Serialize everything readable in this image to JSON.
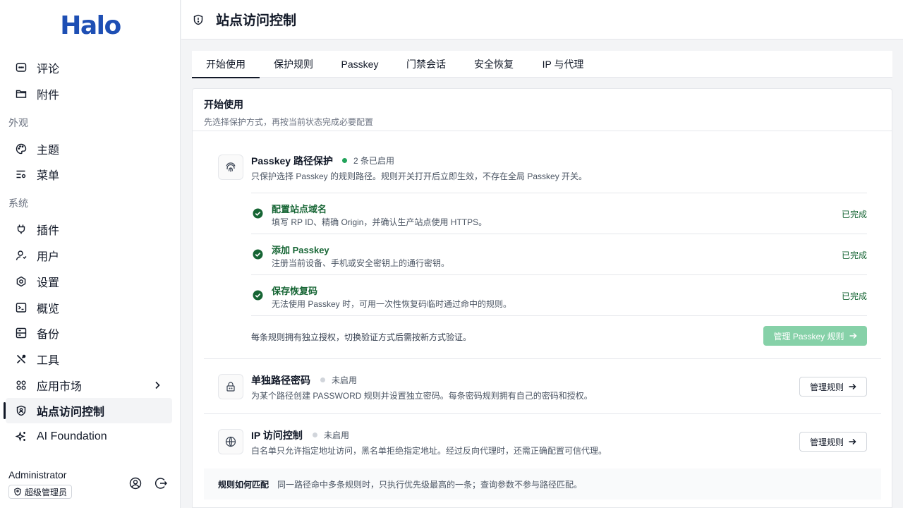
{
  "app": {
    "logo": "Halo"
  },
  "sidebar": {
    "items": [
      {
        "label": "评论",
        "icon": "comment-icon"
      },
      {
        "label": "附件",
        "icon": "folder-icon"
      },
      {
        "label": "主题",
        "icon": "palette-icon"
      },
      {
        "label": "菜单",
        "icon": "menu-settings-icon"
      },
      {
        "label": "插件",
        "icon": "plug-icon"
      },
      {
        "label": "用户",
        "icon": "user-icon"
      },
      {
        "label": "设置",
        "icon": "settings-icon"
      },
      {
        "label": "概览",
        "icon": "terminal-icon"
      },
      {
        "label": "备份",
        "icon": "backup-icon"
      },
      {
        "label": "工具",
        "icon": "tools-icon"
      },
      {
        "label": "应用市场",
        "icon": "apps-icon"
      },
      {
        "label": "站点访问控制",
        "icon": "shield-user-icon",
        "active": true
      },
      {
        "label": "AI Foundation",
        "icon": "sparkles-icon"
      }
    ],
    "groups": {
      "appearance": "外观",
      "system": "系统"
    },
    "user": {
      "name": "Administrator",
      "role": "超级管理员"
    }
  },
  "header": {
    "title": "站点访问控制"
  },
  "tabs": [
    {
      "label": "开始使用",
      "active": true
    },
    {
      "label": "保护规则"
    },
    {
      "label": "Passkey"
    },
    {
      "label": "门禁会话"
    },
    {
      "label": "安全恢复"
    },
    {
      "label": "IP 与代理"
    }
  ],
  "card": {
    "title": "开始使用",
    "subtitle": "先选择保护方式，再按当前状态完成必要配置"
  },
  "passkey": {
    "title": "Passkey 路径保护",
    "status": "2 条已启用",
    "status_color": "#22a35a",
    "desc": "只保护选择 Passkey 的规则路径。规则开关打开后立即生效，不存在全局 Passkey 开关。",
    "steps": [
      {
        "title": "配置站点域名",
        "desc": "填写 RP ID、精确 Origin，并确认生产站点使用 HTTPS。",
        "status": "已完成"
      },
      {
        "title": "添加 Passkey",
        "desc": "注册当前设备、手机或安全密钥上的通行密钥。",
        "status": "已完成"
      },
      {
        "title": "保存恢复码",
        "desc": "无法使用 Passkey 时，可用一次性恢复码临时通过命中的规则。",
        "status": "已完成"
      }
    ],
    "note": "每条规则拥有独立授权，切换验证方式后需按新方式验证。",
    "button": "管理 Passkey 规则"
  },
  "password": {
    "title": "单独路径密码",
    "status": "未启用",
    "status_color": "#d1d5db",
    "desc": "为某个路径创建 PASSWORD 规则并设置独立密码。每条密码规则拥有自己的密码和授权。",
    "button": "管理规则"
  },
  "ip": {
    "title": "IP 访问控制",
    "status": "未启用",
    "status_color": "#d1d5db",
    "desc": "白名单只允许指定地址访问，黑名单拒绝指定地址。经过反向代理时，还需正确配置可信代理。",
    "button": "管理规则"
  },
  "footer": {
    "label": "规则如何匹配",
    "text": "同一路径命中多条规则时，只执行优先级最高的一条；查询参数不参与路径匹配。"
  },
  "colors": {
    "brand": "#1e4fb4",
    "success": "#166534",
    "button_green": "#86d1a8"
  }
}
